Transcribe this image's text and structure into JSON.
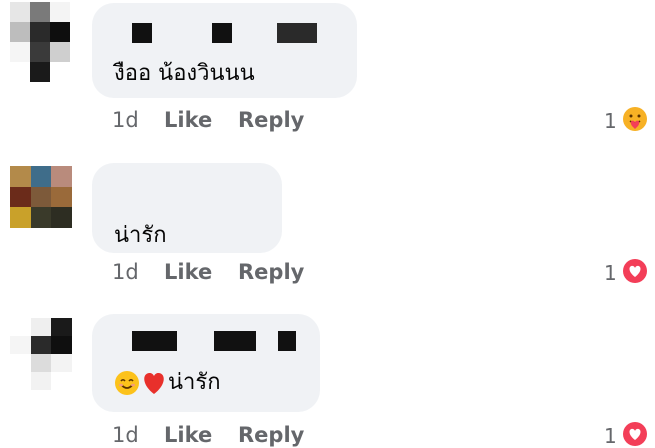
{
  "comments": [
    {
      "text": "งืออ น้องวินนน",
      "time": "1d",
      "like_label": "Like",
      "reply_label": "Reply",
      "reaction_count": "1",
      "reaction": "care-icon"
    },
    {
      "text": "น่ารัก",
      "time": "1d",
      "like_label": "Like",
      "reply_label": "Reply",
      "reaction_count": "1",
      "reaction": "love-icon"
    },
    {
      "text": "น่ารัก",
      "emoji_prefix": [
        "smiling-face-icon",
        "red-heart-icon"
      ],
      "time": "1d",
      "like_label": "Like",
      "reply_label": "Reply",
      "reaction_count": "1",
      "reaction": "love-icon"
    }
  ],
  "colors": {
    "bubble": "#f0f2f5",
    "action_text": "#65676b",
    "love": "#f33e58",
    "care": "#f7b125"
  }
}
